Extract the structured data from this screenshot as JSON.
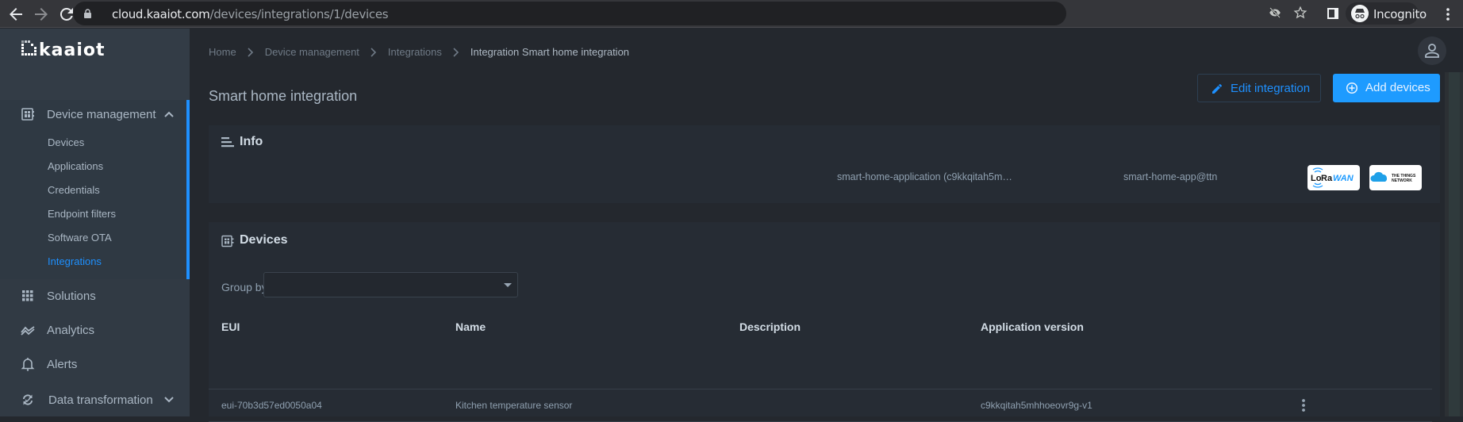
{
  "browser": {
    "url_host": "cloud.kaaiot.com",
    "url_path": "/devices/integrations/1/devices",
    "profile_label": "Incognito"
  },
  "sidebar": {
    "logo_text": "kaaiot",
    "device_management": {
      "label": "Device management",
      "expanded": true,
      "items": [
        {
          "label": "Devices",
          "active": false
        },
        {
          "label": "Applications",
          "active": false
        },
        {
          "label": "Credentials",
          "active": false
        },
        {
          "label": "Endpoint filters",
          "active": false
        },
        {
          "label": "Software OTA",
          "active": false
        },
        {
          "label": "Integrations",
          "active": true
        }
      ]
    },
    "items": [
      {
        "label": "Solutions",
        "icon": "grid-icon"
      },
      {
        "label": "Analytics",
        "icon": "analytics-icon"
      },
      {
        "label": "Alerts",
        "icon": "bell-icon"
      },
      {
        "label": "Data transformation",
        "icon": "sync-icon"
      }
    ]
  },
  "breadcrumb": [
    "Home",
    "Device management",
    "Integrations",
    "Integration Smart home integration"
  ],
  "page": {
    "title": "Smart home integration",
    "edit_label": "Edit integration",
    "add_label": "Add devices"
  },
  "info": {
    "title": "Info",
    "application": "smart-home-application (c9kkqitah5m…",
    "app_id": "smart-home-app@ttn",
    "badges": [
      "LoRaWAN",
      "THE THINGS NETWORK"
    ]
  },
  "devices": {
    "title": "Devices",
    "group_by_label": "Group by",
    "group_by_value": "",
    "columns": [
      "EUI",
      "Name",
      "Description",
      "Application version"
    ],
    "rows": [
      {
        "eui": "eui-70b3d57ed0050a04",
        "name": "Kitchen temperature sensor",
        "description": "",
        "app_version": "c9kkqitah5mhhoeovr9g-v1"
      }
    ]
  },
  "colors": {
    "accent": "#1e90ff",
    "sidebar_bg": "#313a44",
    "main_bg": "#24282e",
    "card_bg": "#262c34"
  }
}
